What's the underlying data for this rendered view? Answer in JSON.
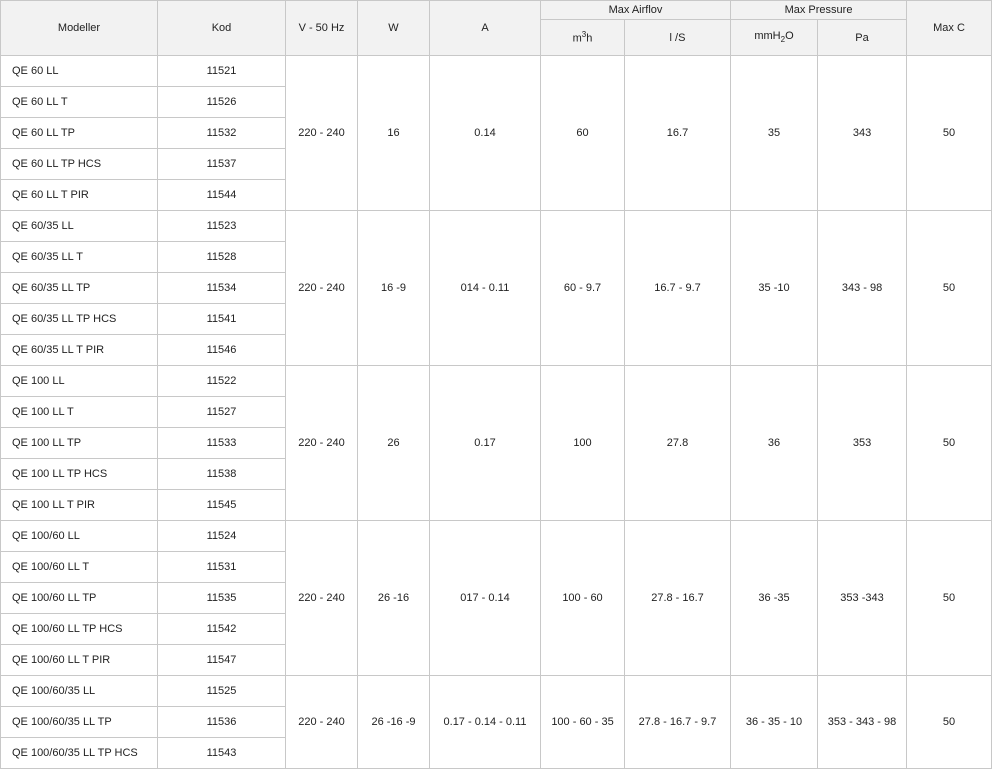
{
  "header": {
    "modeller": "Modeller",
    "kod": "Kod",
    "voltage": "V - 50 Hz",
    "watt": "W",
    "amp": "A",
    "max_airflow": "Max Airflov",
    "max_pressure": "Max Pressure",
    "max_c": "Max C",
    "m3h_a": "m",
    "m3h_sup": "3",
    "m3h_b": "h",
    "ls": "l /S",
    "mmh2o_a": "mmH",
    "mmh2o_sub": "2",
    "mmh2o_b": "O",
    "pa": "Pa"
  },
  "groups": [
    {
      "spec": {
        "v": "220 - 240",
        "w": "16",
        "a": "0.14",
        "m3h": "60",
        "ls": "16.7",
        "mmh2o": "35",
        "pa": "343",
        "maxc": "50"
      },
      "rows": [
        {
          "model": "QE 60 LL",
          "kod": "11521"
        },
        {
          "model": "QE 60 LL T",
          "kod": "11526"
        },
        {
          "model": "QE 60 LL TP",
          "kod": "11532"
        },
        {
          "model": "QE 60 LL TP HCS",
          "kod": "11537"
        },
        {
          "model": "QE 60 LL T PIR",
          "kod": "11544"
        }
      ]
    },
    {
      "spec": {
        "v": "220 - 240",
        "w": "16 -9",
        "a": "014 - 0.11",
        "m3h": "60 - 9.7",
        "ls": "16.7 - 9.7",
        "mmh2o": "35 -10",
        "pa": "343 - 98",
        "maxc": "50"
      },
      "rows": [
        {
          "model": "QE 60/35 LL",
          "kod": "11523"
        },
        {
          "model": "QE 60/35 LL T",
          "kod": "11528"
        },
        {
          "model": "QE 60/35 LL TP",
          "kod": "11534"
        },
        {
          "model": "QE 60/35 LL TP HCS",
          "kod": "11541"
        },
        {
          "model": "QE 60/35 LL T PIR",
          "kod": "11546"
        }
      ]
    },
    {
      "spec": {
        "v": "220 - 240",
        "w": "26",
        "a": "0.17",
        "m3h": "100",
        "ls": "27.8",
        "mmh2o": "36",
        "pa": "353",
        "maxc": "50"
      },
      "rows": [
        {
          "model": "QE 100 LL",
          "kod": "11522"
        },
        {
          "model": "QE 100 LL T",
          "kod": "11527"
        },
        {
          "model": "QE 100 LL TP",
          "kod": "11533"
        },
        {
          "model": "QE 100 LL TP HCS",
          "kod": "11538"
        },
        {
          "model": "QE 100 LL T PIR",
          "kod": "11545"
        }
      ]
    },
    {
      "spec": {
        "v": "220 - 240",
        "w": "26 -16",
        "a": "017 - 0.14",
        "m3h": "100 - 60",
        "ls": "27.8 - 16.7",
        "mmh2o": "36 -35",
        "pa": "353 -343",
        "maxc": "50"
      },
      "rows": [
        {
          "model": "QE 100/60 LL",
          "kod": "11524"
        },
        {
          "model": "QE 100/60 LL T",
          "kod": "11531"
        },
        {
          "model": "QE 100/60 LL TP",
          "kod": "11535"
        },
        {
          "model": "QE 100/60 LL TP HCS",
          "kod": "11542"
        },
        {
          "model": "QE 100/60 LL T PIR",
          "kod": "11547"
        }
      ]
    },
    {
      "spec": {
        "v": "220 - 240",
        "w": "26 -16 -9",
        "a": "0.17 - 0.14 - 0.11",
        "m3h": "100 - 60 - 35",
        "ls": "27.8 - 16.7 - 9.7",
        "mmh2o": "36 - 35 - 10",
        "pa": "353 - 343 - 98",
        "maxc": "50"
      },
      "rows": [
        {
          "model": "QE 100/60/35 LL",
          "kod": "11525"
        },
        {
          "model": "QE 100/60/35 LL TP",
          "kod": "11536"
        },
        {
          "model": "QE 100/60/35 LL TP HCS",
          "kod": "11543"
        }
      ]
    }
  ]
}
